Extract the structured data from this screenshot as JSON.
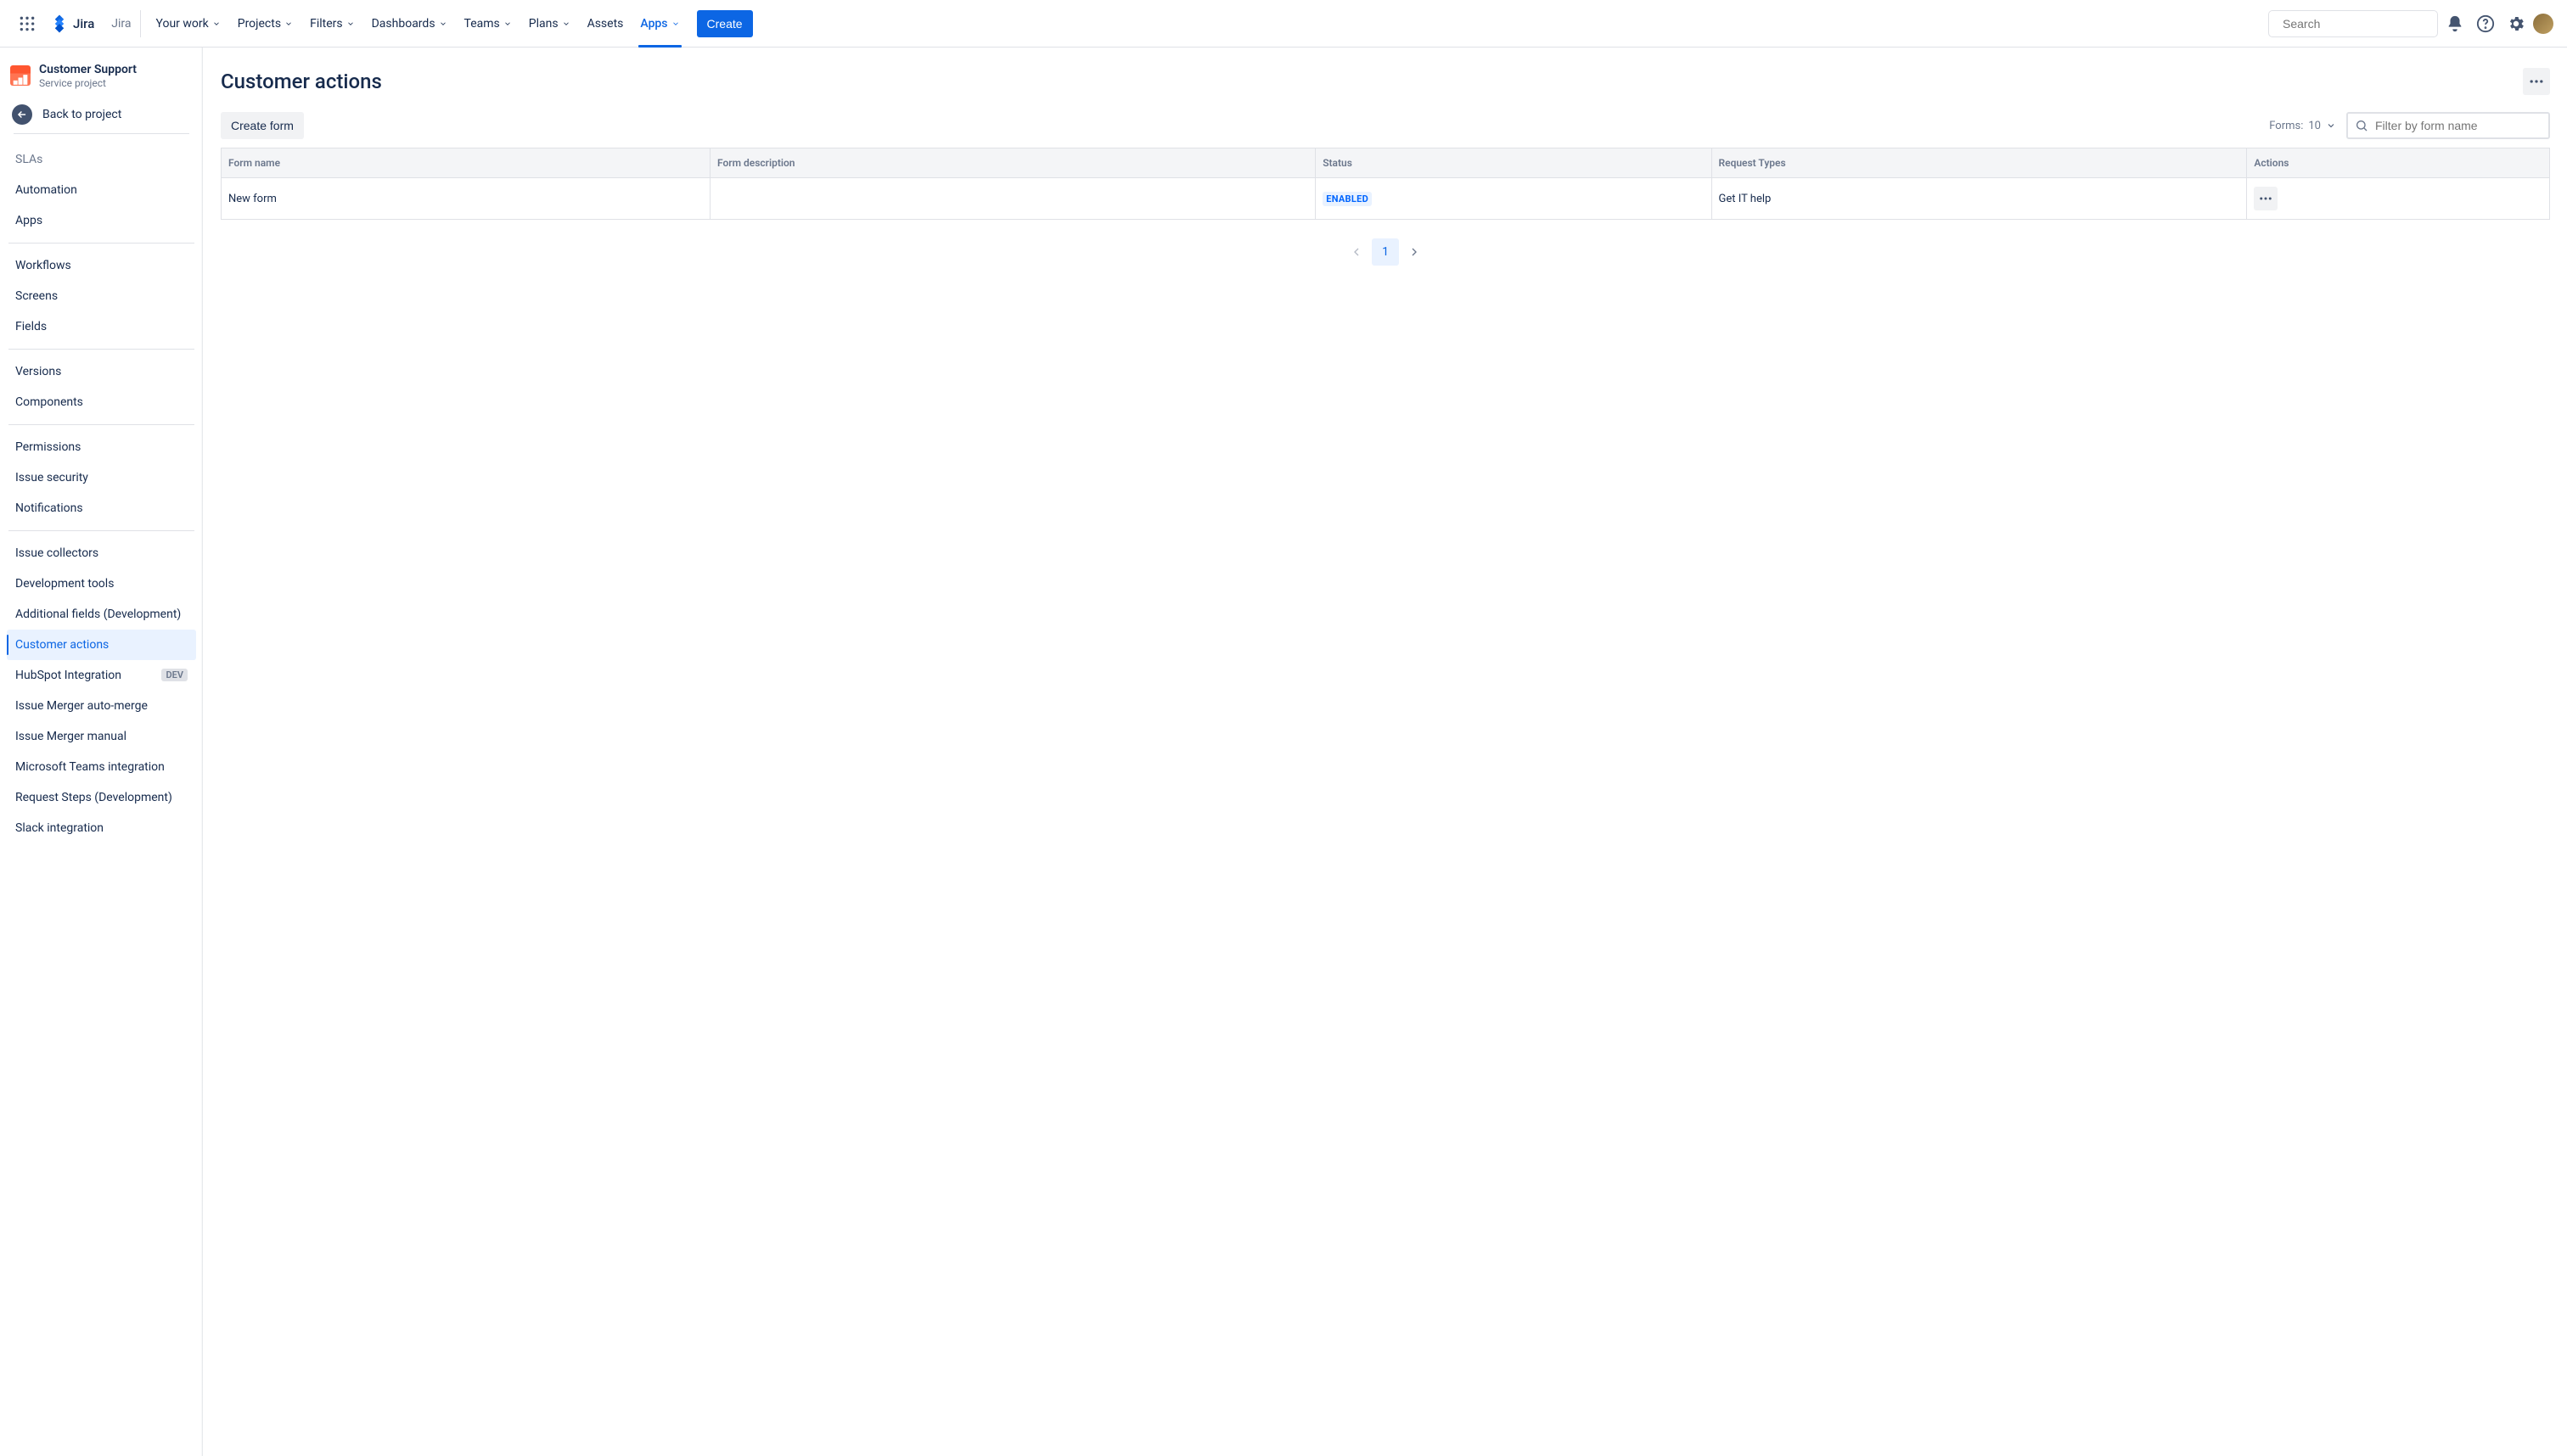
{
  "topnav": {
    "logo_text": "Jira",
    "jira_label": "Jira",
    "items": [
      {
        "label": "Your work",
        "dropdown": true,
        "active": false
      },
      {
        "label": "Projects",
        "dropdown": true,
        "active": false
      },
      {
        "label": "Filters",
        "dropdown": true,
        "active": false
      },
      {
        "label": "Dashboards",
        "dropdown": true,
        "active": false
      },
      {
        "label": "Teams",
        "dropdown": true,
        "active": false
      },
      {
        "label": "Plans",
        "dropdown": true,
        "active": false
      },
      {
        "label": "Assets",
        "dropdown": false,
        "active": false
      },
      {
        "label": "Apps",
        "dropdown": true,
        "active": true
      }
    ],
    "create_label": "Create",
    "search_placeholder": "Search"
  },
  "sidebar": {
    "project_name": "Customer Support",
    "project_type": "Service project",
    "back_label": "Back to project",
    "truncated_item": "SLAs",
    "groups": [
      [
        {
          "label": "Automation"
        },
        {
          "label": "Apps"
        }
      ],
      [
        {
          "label": "Workflows"
        },
        {
          "label": "Screens"
        },
        {
          "label": "Fields"
        }
      ],
      [
        {
          "label": "Versions"
        },
        {
          "label": "Components"
        }
      ],
      [
        {
          "label": "Permissions"
        },
        {
          "label": "Issue security"
        },
        {
          "label": "Notifications"
        }
      ],
      [
        {
          "label": "Issue collectors"
        },
        {
          "label": "Development tools"
        },
        {
          "label": "Additional fields (Development)"
        },
        {
          "label": "Customer actions",
          "selected": true
        },
        {
          "label": "HubSpot Integration",
          "badge": "DEV"
        },
        {
          "label": "Issue Merger auto-merge"
        },
        {
          "label": "Issue Merger manual"
        },
        {
          "label": "Microsoft Teams integration"
        },
        {
          "label": "Request Steps (Development)"
        },
        {
          "label": "Slack integration"
        }
      ]
    ]
  },
  "page": {
    "title": "Customer actions",
    "create_form_label": "Create form",
    "forms_count_label": "Forms:",
    "forms_count_value": "10",
    "filter_placeholder": "Filter by form name",
    "table": {
      "headers": [
        "Form name",
        "Form description",
        "Status",
        "Request Types",
        "Actions"
      ],
      "rows": [
        {
          "name": "New form",
          "description": "",
          "status": "ENABLED",
          "request_types": "Get IT help"
        }
      ]
    },
    "pagination": {
      "current": "1"
    }
  }
}
